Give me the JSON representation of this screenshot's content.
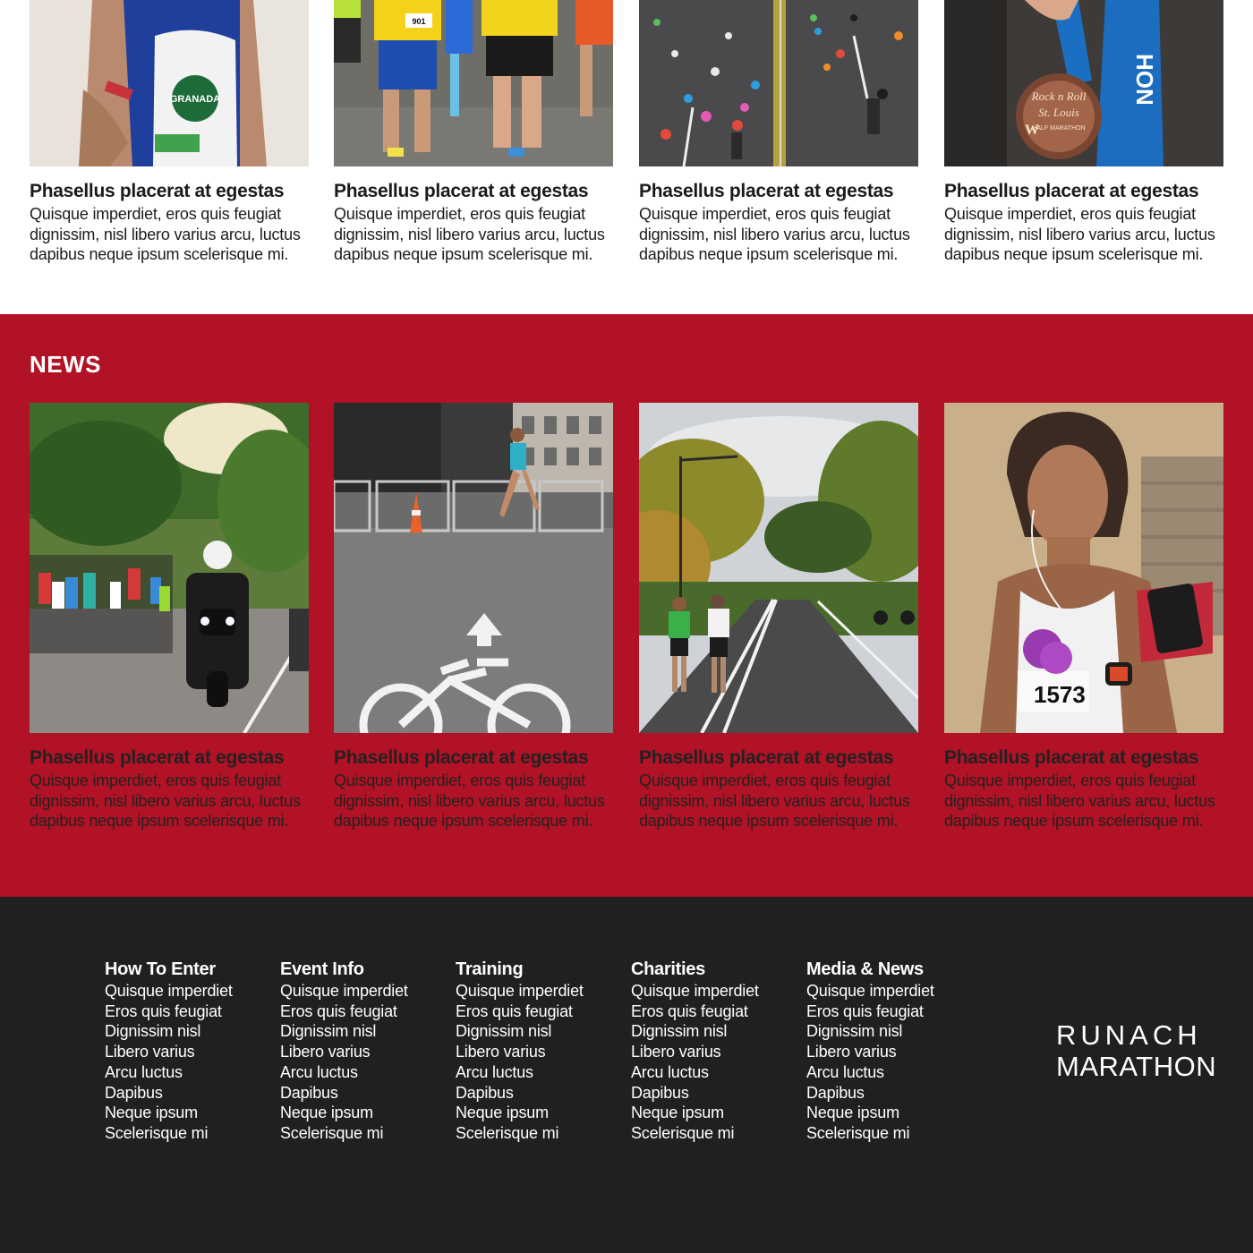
{
  "top_cards": [
    {
      "title": "Phasellus placerat at egestas",
      "text": "Quisque imperdiet, eros quis feugiat dignissim, nisl libero varius arcu, luctus dapibus neque ipsum scelerisque mi.",
      "photo_alt": "triathlete-photo"
    },
    {
      "title": "Phasellus placerat at egestas",
      "text": "Quisque imperdiet, eros quis feugiat dignissim, nisl libero varius arcu, luctus dapibus neque ipsum scelerisque mi.",
      "photo_alt": "runners-legs-photo"
    },
    {
      "title": "Phasellus placerat at egestas",
      "text": "Quisque imperdiet, eros quis feugiat dignissim, nisl libero varius arcu, luctus dapibus neque ipsum scelerisque mi.",
      "photo_alt": "crowd-runners-road-photo"
    },
    {
      "title": "Phasellus placerat at egestas",
      "text": "Quisque imperdiet, eros quis feugiat dignissim, nisl libero varius arcu, luctus dapibus neque ipsum scelerisque mi.",
      "photo_alt": "medal-photo"
    }
  ],
  "news": {
    "heading": "NEWS",
    "cards": [
      {
        "title": "Phasellus placerat at egestas",
        "text": "Quisque imperdiet, eros quis feugiat dignissim, nisl libero varius arcu, luctus dapibus neque ipsum scelerisque mi.",
        "photo_alt": "motorcycle-runners-photo"
      },
      {
        "title": "Phasellus placerat at egestas",
        "text": "Quisque imperdiet, eros quis feugiat dignissim, nisl libero varius arcu, luctus dapibus neque ipsum scelerisque mi.",
        "photo_alt": "runner-bike-lane-photo"
      },
      {
        "title": "Phasellus placerat at egestas",
        "text": "Quisque imperdiet, eros quis feugiat dignissim, nisl libero varius arcu, luctus dapibus neque ipsum scelerisque mi.",
        "photo_alt": "park-road-runners-photo"
      },
      {
        "title": "Phasellus placerat at egestas",
        "text": "Quisque imperdiet, eros quis feugiat dignissim, nisl libero varius arcu, luctus dapibus neque ipsum scelerisque mi.",
        "photo_alt": "woman-runner-photo"
      }
    ]
  },
  "footer": {
    "columns": [
      {
        "heading": "How To Enter",
        "links": [
          "Quisque imperdiet",
          "Eros quis feugiat",
          "Dignissim nisl",
          "Libero varius",
          "Arcu luctus",
          "Dapibus",
          "Neque ipsum",
          "Scelerisque mi"
        ]
      },
      {
        "heading": "Event Info",
        "links": [
          "Quisque imperdiet",
          "Eros quis feugiat",
          "Dignissim nisl",
          "Libero varius",
          "Arcu luctus",
          "Dapibus",
          "Neque ipsum",
          "Scelerisque mi"
        ]
      },
      {
        "heading": "Training",
        "links": [
          "Quisque imperdiet",
          "Eros quis feugiat",
          "Dignissim nisl",
          "Libero varius",
          "Arcu luctus",
          "Dapibus",
          "Neque ipsum",
          "Scelerisque mi"
        ]
      },
      {
        "heading": "Charities",
        "links": [
          "Quisque imperdiet",
          "Eros quis feugiat",
          "Dignissim nisl",
          "Libero varius",
          "Arcu luctus",
          "Dapibus",
          "Neque ipsum",
          "Scelerisque mi"
        ]
      },
      {
        "heading": "Media & News",
        "links": [
          "Quisque imperdiet",
          "Eros quis feugiat",
          "Dignissim nisl",
          "Libero varius",
          "Arcu luctus",
          "Dapibus",
          "Neque ipsum",
          "Scelerisque mi"
        ]
      }
    ],
    "logo_line1": "RUNACH",
    "logo_line2": "MARATHON"
  },
  "colors": {
    "news_bg": "#b11225",
    "footer_bg": "#202020",
    "page_bg": "#ffffff"
  }
}
